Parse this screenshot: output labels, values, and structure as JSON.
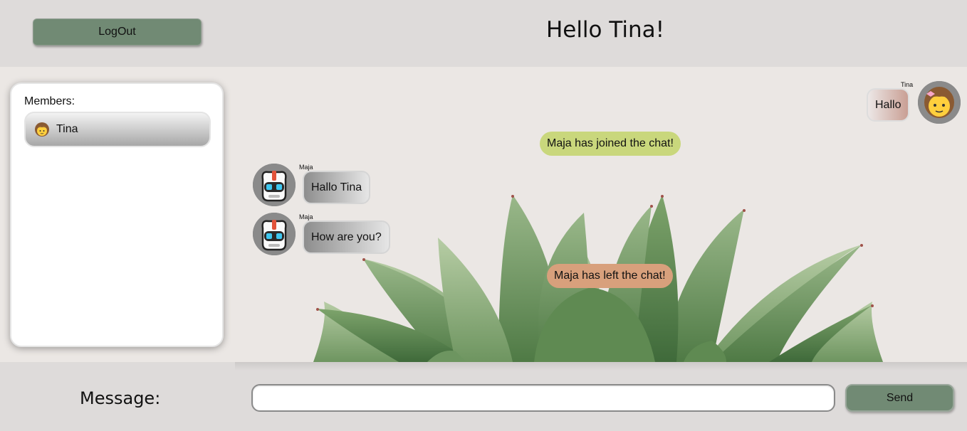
{
  "header": {
    "logout_label": "LogOut",
    "greeting": "Hello Tina!"
  },
  "members": {
    "title": "Members:",
    "items": [
      {
        "name": "Tina",
        "avatar": "girl-avatar-icon"
      }
    ]
  },
  "chat": {
    "messages": [
      {
        "type": "outgoing",
        "sender": "Tina",
        "text": "Hallo",
        "avatar": "girl-avatar-icon"
      },
      {
        "type": "system",
        "text": "Maja has joined the chat!"
      },
      {
        "type": "incoming",
        "sender": "Maja",
        "text": "Hallo Tina",
        "avatar": "robot-avatar-icon"
      },
      {
        "type": "incoming",
        "sender": "Maja",
        "text": "How are you?",
        "avatar": "robot-avatar-icon"
      },
      {
        "type": "system",
        "text": "Maja has left the chat!"
      }
    ]
  },
  "composer": {
    "label": "Message:",
    "input_value": "",
    "send_label": "Send"
  },
  "colors": {
    "header_bg": "#dedbda",
    "button_green": "#718a74",
    "join_badge": "#c9d77c",
    "leave_badge": "#d8a07c"
  }
}
